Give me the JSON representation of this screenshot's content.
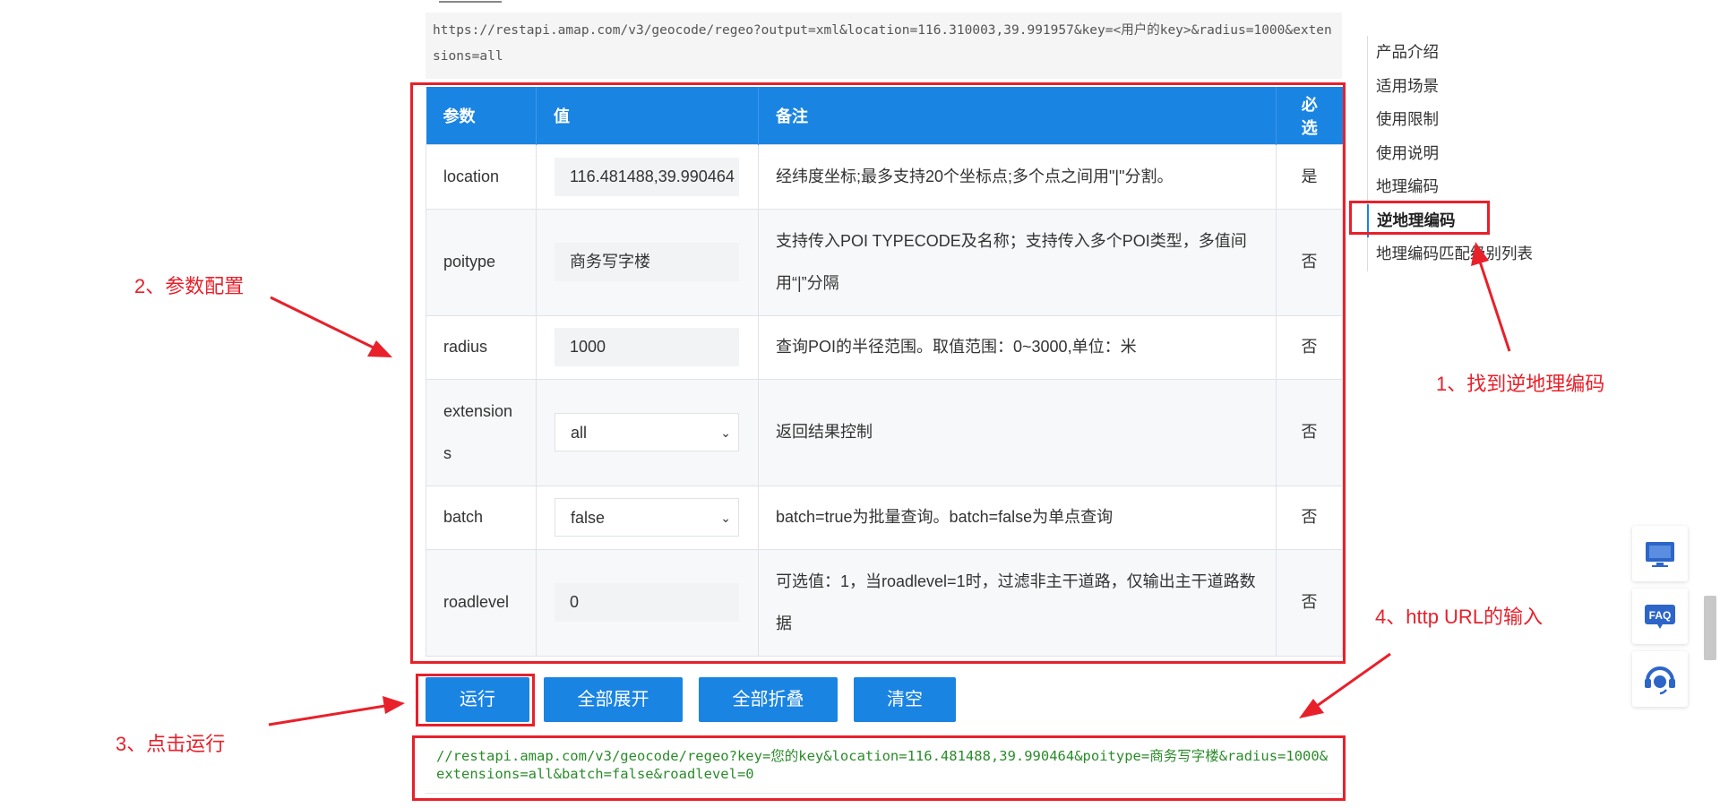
{
  "request_url": "https://restapi.amap.com/v3/geocode/regeo?output=xml&location=116.310003,39.991957&key=<用户的key>&radius=1000&extensions=all",
  "table": {
    "headers": [
      "参数",
      "值",
      "备注",
      "必选"
    ],
    "rows": [
      {
        "param": "location",
        "value": "116.481488,39.990464",
        "control": "input",
        "note": "经纬度坐标;最多支持20个坐标点;多个点之间用\"|\"分割。",
        "required": "是"
      },
      {
        "param": "poitype",
        "value": "商务写字楼",
        "control": "input",
        "note": "支持传入POI TYPECODE及名称；支持传入多个POI类型，多值间用“|”分隔",
        "required": "否"
      },
      {
        "param": "radius",
        "value": "1000",
        "control": "input",
        "note": "查询POI的半径范围。取值范围：0~3000,单位：米",
        "required": "否"
      },
      {
        "param": "extensions",
        "value": "all",
        "control": "select",
        "note": "返回结果控制",
        "required": "否"
      },
      {
        "param": "batch",
        "value": "false",
        "control": "select",
        "note": "batch=true为批量查询。batch=false为单点查询",
        "required": "否"
      },
      {
        "param": "roadlevel",
        "value": "0",
        "control": "input",
        "note": "可选值：1，当roadlevel=1时，过滤非主干道路，仅输出主干道路数据",
        "required": "否"
      }
    ]
  },
  "buttons": {
    "run": "运行",
    "expand_all": "全部展开",
    "collapse_all": "全部折叠",
    "clear": "清空"
  },
  "output_url": "//restapi.amap.com/v3/geocode/regeo?key=您的key&location=116.481488,39.990464&poitype=商务写字楼&radius=1000&extensions=all&batch=false&roadlevel=0",
  "toc": {
    "items": [
      "产品介绍",
      "适用场景",
      "使用限制",
      "使用说明",
      "地理编码",
      "逆地理编码",
      "地理编码匹配级别列表"
    ],
    "active_index": 5
  },
  "annotations": {
    "step1": "1、找到逆地理编码",
    "step2": "2、参数配置",
    "step3": "3、点击运行",
    "step4": "4、http URL的输入"
  },
  "colors": {
    "primary": "#1a84e3",
    "annotation": "#e8202a",
    "output_text": "#2a8b2a"
  },
  "icons": [
    "feedback-monitor-icon",
    "faq-icon",
    "customer-service-icon",
    "chevron-down-icon"
  ]
}
